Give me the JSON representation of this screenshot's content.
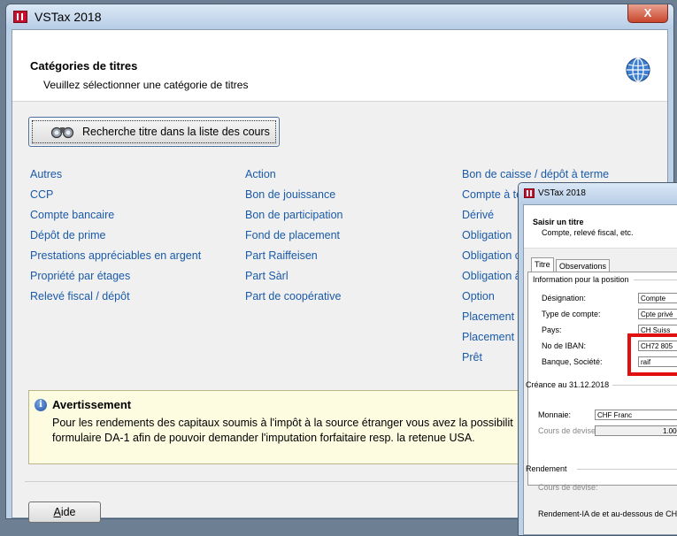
{
  "window": {
    "title": "VSTax 2018",
    "close_label": "X"
  },
  "header": {
    "title": "Catégories de titres",
    "subtitle": "Veuillez sélectionner une catégorie de titres"
  },
  "search_button": {
    "label": "Recherche titre dans la liste des cours"
  },
  "categories": {
    "col1": [
      "Autres",
      "CCP",
      "Compte bancaire",
      "Dépôt de prime",
      "Prestations appréciables en argent",
      "Propriété par étages",
      "Relevé fiscal / dépôt"
    ],
    "col2": [
      "Action",
      "Bon de jouissance",
      "Bon de participation",
      "Fond de placement",
      "Part Raiffeisen",
      "Part Sàrl",
      "Part de coopérative"
    ],
    "col3": [
      "Bon de caisse / dépôt à terme",
      "Compte à te",
      "Dérivé",
      "Obligation",
      "Obligation c",
      "Obligation à",
      "Option",
      "Placement n",
      "Placement n",
      "Prêt"
    ]
  },
  "warning": {
    "title": "Avertissement",
    "line1": "Pour les rendements des capitaux soumis à l'impôt à la source étranger vous avez la possibilit",
    "line2": "formulaire DA-1 afin de pouvoir demander l'imputation forfaitaire resp. la retenue USA."
  },
  "footer": {
    "help_prefix": "",
    "help_underlined": "A",
    "help_rest": "ide"
  },
  "dialog": {
    "title": "VSTax 2018",
    "heading": "Saisir un titre",
    "subheading": "Compte, relevé fiscal, etc.",
    "tabs": [
      "Titre",
      "Observations"
    ],
    "section_position": "Information pour la position",
    "labels": {
      "designation": "Désignation:",
      "account_type": "Type de compte:",
      "country": "Pays:",
      "iban": "No de IBAN:",
      "bank": "Banque, Société:"
    },
    "values": {
      "designation": "Compte",
      "account_type": "Cpte privé",
      "country": "CH  Suiss",
      "iban": "CH72 805",
      "bank": "raif"
    },
    "section_claim": "Créance au 31.12.2018",
    "currency_label": "Monnaie:",
    "currency_value": "CHF  Franc",
    "rate_label": "Cours de devise:",
    "rate_value": "1.000",
    "section_yield": "Rendement",
    "yield_rate_label": "Cours de devise:",
    "yield_note": "Rendement-IA de et au-dessous de CHF"
  }
}
